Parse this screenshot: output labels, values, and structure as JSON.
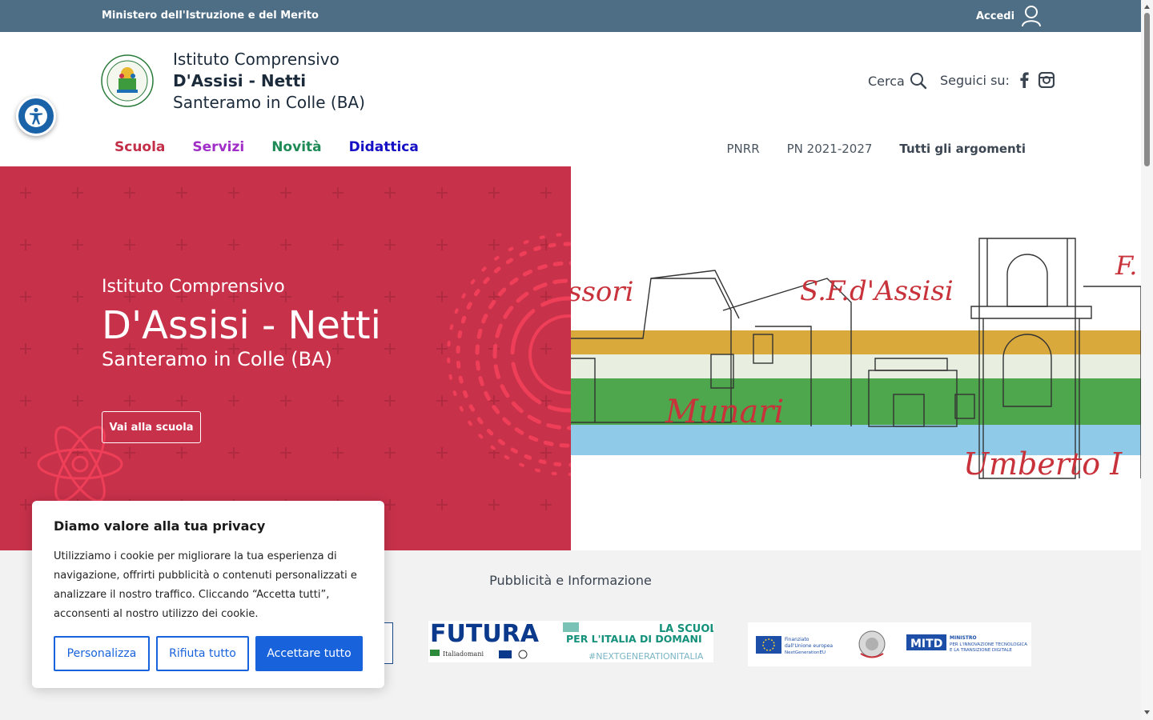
{
  "colors": {
    "topbar": "#4e6e86",
    "hero_red": "#c8314a",
    "nav_scuola": "#c32f48",
    "nav_servizi": "#a02ec7",
    "nav_novita": "#1e8a55",
    "nav_didattica": "#1510c4",
    "cookie_blue": "#1863dc"
  },
  "topbar": {
    "ministry": "Ministero dell'Istruzione e del Merito",
    "login_label": "Accedi",
    "login_icon": "user-icon"
  },
  "header": {
    "school_line1": "Istituto Comprensivo",
    "school_line2": "D'Assisi - Netti",
    "school_line3": "Santeramo in Colle (BA)",
    "search_label": "Cerca",
    "follow_label": "Seguici su:",
    "main_nav": [
      "Scuola",
      "Servizi",
      "Novità",
      "Didattica"
    ],
    "sub_nav": [
      "PNRR",
      "PN 2021-2027",
      "Tutti gli argomenti"
    ]
  },
  "hero": {
    "line1": "Istituto Comprensivo",
    "line2": "D'Assisi - Netti",
    "line3": "Santeramo in Colle (BA)",
    "button": "Vai alla scuola",
    "image_labels": [
      "ssori",
      "S.F.d'Assisi",
      "F.",
      "Munari",
      "Umberto I"
    ]
  },
  "promo": {
    "title": "Pubblicità e Informazione",
    "futura_word": "FUTURA",
    "futura_slogan_1": "LA SCUOLA",
    "futura_slogan_2": "PER L'ITALIA DI DOMANI",
    "futura_hashtag": "#NEXTGENERATIONITALIA",
    "futura_brand": "Italiadomani",
    "eu_line1": "Finanziato",
    "eu_line2": "dall'Unione europea",
    "eu_line3": "NextGenerationEU",
    "mitd_acronym": "MITD",
    "mitd_line1": "MINISTRO",
    "mitd_line2": "PER L'INNOVAZIONE TECNOLOGICA",
    "mitd_line3": "E LA TRANSIZIONE DIGITALE"
  },
  "cookie": {
    "title": "Diamo valore alla tua privacy",
    "body": "Utilizziamo i cookie per migliorare la tua esperienza di navigazione, offrirti pubblicità o contenuti personalizzati e analizzare il nostro traffico. Cliccando “Accetta tutti”, acconsenti al nostro utilizzo dei cookie.",
    "customize": "Personalizza",
    "reject": "Rifiuta tutto",
    "accept": "Accettare tutto"
  }
}
